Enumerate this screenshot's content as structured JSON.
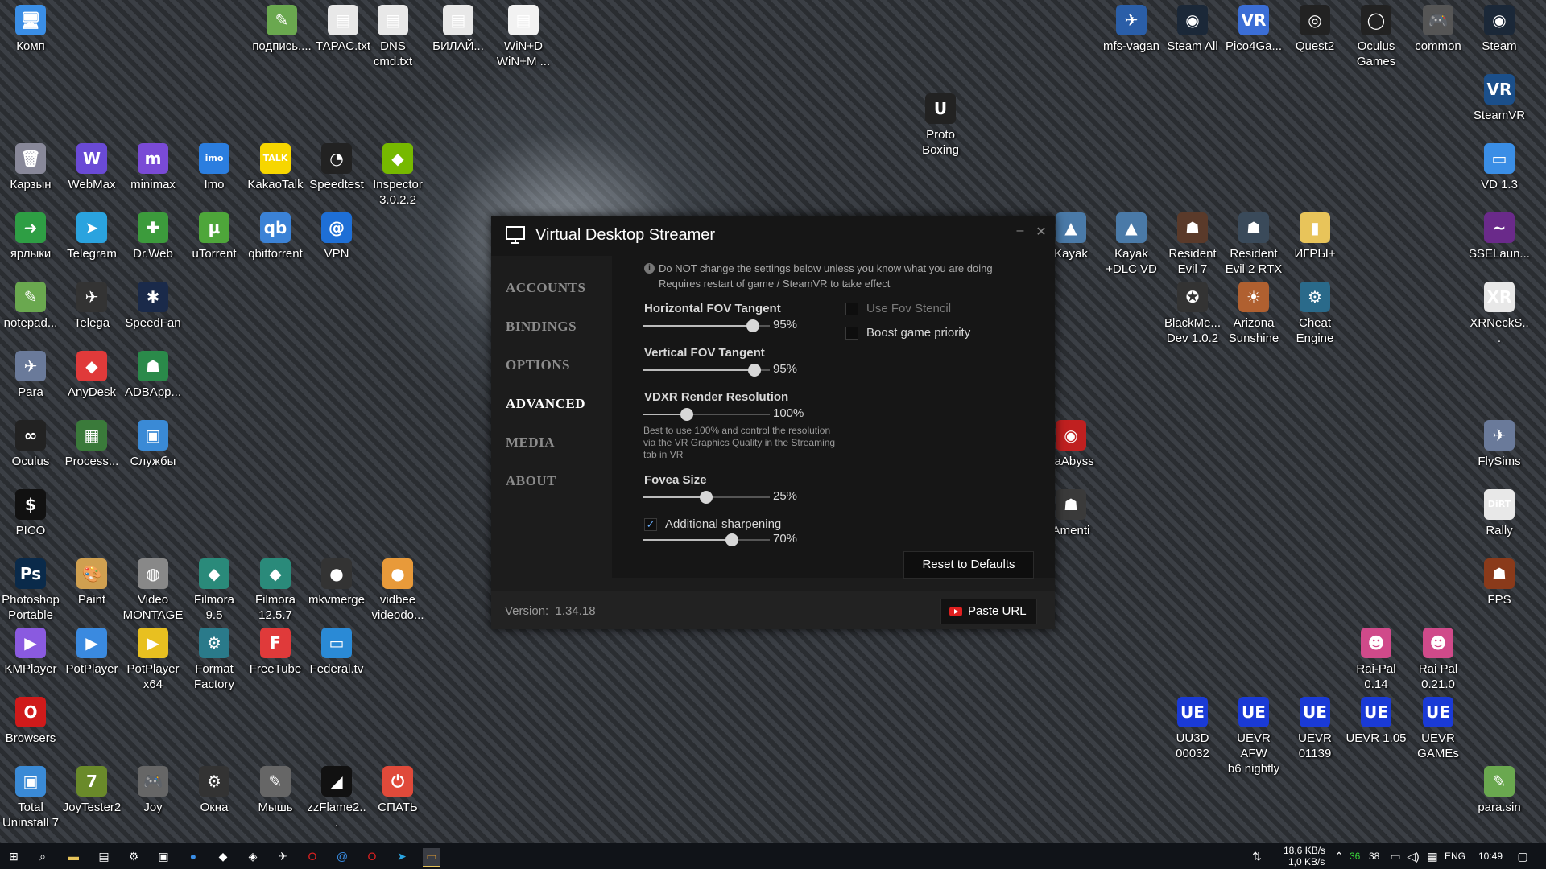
{
  "desktop_icons": [
    {
      "label": "Комп",
      "glyph": "🖥",
      "color": "#3a8ee6",
      "name": "computer-icon"
    },
    {
      "label": "подпись....",
      "glyph": "✎",
      "color": "#6aa84f",
      "name": "notepad-file-icon"
    },
    {
      "label": "ТАРАС.txt",
      "glyph": "▤",
      "color": "#e8e8e8",
      "name": "text-file-icon"
    },
    {
      "label": "DNS\ncmd.txt",
      "glyph": "▤",
      "color": "#e8e8e8",
      "name": "text-file-icon"
    },
    {
      "label": "БИЛАЙ...",
      "glyph": "▤",
      "color": "#e8e8e8",
      "name": "text-file-icon"
    },
    {
      "label": "WiN+D\nWiN+M ...",
      "glyph": "▤",
      "color": "#f2f2f2",
      "name": "text-file-icon"
    },
    {
      "label": "mfs-vagan",
      "glyph": "✈",
      "color": "#2a5ea8",
      "name": "flight-sim-icon"
    },
    {
      "label": "Steam All",
      "glyph": "◉",
      "color": "#1b2838",
      "name": "steam-icon"
    },
    {
      "label": "Pico4Ga...",
      "glyph": "VR",
      "color": "#3b6ed6",
      "name": "vr-icon"
    },
    {
      "label": "Quest2",
      "glyph": "◎",
      "color": "#222",
      "name": "quest-icon"
    },
    {
      "label": "Oculus\nGames",
      "glyph": "◯",
      "color": "#222",
      "name": "oculus-icon"
    },
    {
      "label": "common",
      "glyph": "🎮",
      "color": "#555",
      "name": "gamepad-icon"
    },
    {
      "label": "Steam",
      "glyph": "◉",
      "color": "#1b2838",
      "name": "steam-icon"
    },
    {
      "label": "SteamVR",
      "glyph": "VR",
      "color": "#1b4f8a",
      "name": "steamvr-icon"
    },
    {
      "label": "Proto\nBoxing",
      "glyph": "U",
      "color": "#222",
      "name": "unreal-icon"
    },
    {
      "label": "Карзын",
      "glyph": "🗑",
      "color": "#889",
      "name": "recycle-bin-icon"
    },
    {
      "label": "WebMax",
      "glyph": "W",
      "color": "#6a4ad6",
      "name": "webmax-icon"
    },
    {
      "label": "minimax",
      "glyph": "m",
      "color": "#7a4ad6",
      "name": "minimax-icon"
    },
    {
      "label": "Imo",
      "glyph": "imo",
      "color": "#2b7ee0",
      "name": "imo-icon"
    },
    {
      "label": "KakaoTalk",
      "glyph": "TALK",
      "color": "#f7d600",
      "name": "kakaotalk-icon"
    },
    {
      "label": "Speedtest",
      "glyph": "◔",
      "color": "#222",
      "name": "speedtest-icon"
    },
    {
      "label": "Inspector\n3.0.2.2",
      "glyph": "◆",
      "color": "#76b900",
      "name": "nvidia-icon"
    },
    {
      "label": "VD 1.3",
      "glyph": "▭",
      "color": "#3a8ee6",
      "name": "vd-icon"
    },
    {
      "label": "ярлыки",
      "glyph": "➜",
      "color": "#2e9e44",
      "name": "shortcuts-icon"
    },
    {
      "label": "Telegram",
      "glyph": "➤",
      "color": "#2aa3df",
      "name": "telegram-icon"
    },
    {
      "label": "Dr.Web",
      "glyph": "✚",
      "color": "#3c9b3c",
      "name": "drweb-icon"
    },
    {
      "label": "uTorrent",
      "glyph": "µ",
      "color": "#4ea63a",
      "name": "utorrent-icon"
    },
    {
      "label": "qbittorrent",
      "glyph": "qb",
      "color": "#3b82d6",
      "name": "qbittorrent-icon"
    },
    {
      "label": "VPN",
      "glyph": "@",
      "color": "#1e6fd6",
      "name": "vpn-icon"
    },
    {
      "label": "Kayak",
      "glyph": "▲",
      "color": "#4a7aa8",
      "name": "kayak-icon"
    },
    {
      "label": "Kayak\n+DLC VD",
      "glyph": "▲",
      "color": "#4a7aa8",
      "name": "kayak-icon"
    },
    {
      "label": "Resident\nEvil 7",
      "glyph": "☗",
      "color": "#5a3a2a",
      "name": "game-icon"
    },
    {
      "label": "Resident\nEvil 2 RTX",
      "glyph": "☗",
      "color": "#3a4a5a",
      "name": "game-icon"
    },
    {
      "label": "ИГРЫ+",
      "glyph": "▮",
      "color": "#e8c45a",
      "name": "folder-icon"
    },
    {
      "label": "SSELaun...",
      "glyph": "~",
      "color": "#6a2a8a",
      "name": "game-icon"
    },
    {
      "label": "notepad...",
      "glyph": "✎",
      "color": "#6aa84f",
      "name": "notepad-icon"
    },
    {
      "label": "Telega",
      "glyph": "✈",
      "color": "#333",
      "name": "telega-icon"
    },
    {
      "label": "SpeedFan",
      "glyph": "✱",
      "color": "#1a2a4a",
      "name": "speedfan-icon"
    },
    {
      "label": "BlackMe...\nDev 1.0.2",
      "glyph": "✪",
      "color": "#333",
      "name": "game-icon"
    },
    {
      "label": "Arizona\nSunshine",
      "glyph": "☀",
      "color": "#b06030",
      "name": "game-icon"
    },
    {
      "label": "Cheat\nEngine",
      "glyph": "⚙",
      "color": "#2a6a8a",
      "name": "cheat-engine-icon"
    },
    {
      "label": "XRNeckS...",
      "glyph": "XR",
      "color": "#e8e8e8",
      "name": "xr-icon"
    },
    {
      "label": "Para",
      "glyph": "✈",
      "color": "#6a7a9a",
      "name": "para-icon"
    },
    {
      "label": "AnyDesk",
      "glyph": "◆",
      "color": "#e03a3a",
      "name": "anydesk-icon"
    },
    {
      "label": "ADBApp...",
      "glyph": "☗",
      "color": "#2a8a4a",
      "name": "adb-icon"
    },
    {
      "label": "Oculus",
      "glyph": "∞",
      "color": "#222",
      "name": "meta-icon"
    },
    {
      "label": "Process...",
      "glyph": "▦",
      "color": "#3a7a3a",
      "name": "process-icon"
    },
    {
      "label": "Службы",
      "glyph": "▣",
      "color": "#3a8ad6",
      "name": "services-icon"
    },
    {
      "label": "naAbyss",
      "glyph": "◉",
      "color": "#c02020",
      "name": "game-icon"
    },
    {
      "label": "FlySims",
      "glyph": "✈",
      "color": "#6a7a9a",
      "name": "flysims-icon"
    },
    {
      "label": "PICO",
      "glyph": "$",
      "color": "#111",
      "name": "pico-icon"
    },
    {
      "label": "Amenti",
      "glyph": "☗",
      "color": "#3a3a3a",
      "name": "game-icon"
    },
    {
      "label": "Rally",
      "glyph": "DiRT",
      "color": "#e8e8e8",
      "name": "dirt-icon"
    },
    {
      "label": "Photoshop\nPortable",
      "glyph": "Ps",
      "color": "#0a2a4a",
      "name": "photoshop-icon"
    },
    {
      "label": "Paint",
      "glyph": "🎨",
      "color": "#d0a050",
      "name": "paint-icon"
    },
    {
      "label": "Video\nMONTAGE",
      "glyph": "◍",
      "color": "#888",
      "name": "video-montage-icon"
    },
    {
      "label": "Filmora\n9.5",
      "glyph": "◆",
      "color": "#2a8a7a",
      "name": "filmora-icon"
    },
    {
      "label": "Filmora\n12.5.7",
      "glyph": "◆",
      "color": "#2a8a7a",
      "name": "filmora-icon"
    },
    {
      "label": "mkvmerge",
      "glyph": "●",
      "color": "#333",
      "name": "mkvmerge-icon"
    },
    {
      "label": "vidbee\nvideodo...",
      "glyph": "●",
      "color": "#e89a3a",
      "name": "vidbee-icon"
    },
    {
      "label": "FPS",
      "glyph": "☗",
      "color": "#8a3a1a",
      "name": "game-icon"
    },
    {
      "label": "KMPlayer",
      "glyph": "▶",
      "color": "#8a5ae0",
      "name": "kmplayer-icon"
    },
    {
      "label": "PotPlayer",
      "glyph": "▶",
      "color": "#3a8ae0",
      "name": "potplayer-icon"
    },
    {
      "label": "PotPlayer\nx64",
      "glyph": "▶",
      "color": "#e8c020",
      "name": "potplayer-icon"
    },
    {
      "label": "Format\nFactory",
      "glyph": "⚙",
      "color": "#2a7a8a",
      "name": "format-factory-icon"
    },
    {
      "label": "FreeTube",
      "glyph": "F",
      "color": "#e03a3a",
      "name": "freetube-icon"
    },
    {
      "label": "Federal.tv",
      "glyph": "▭",
      "color": "#2a8ad6",
      "name": "federal-tv-icon"
    },
    {
      "label": "Rai-Pal\n0.14",
      "glyph": "☻",
      "color": "#d04a8a",
      "name": "raipal-icon"
    },
    {
      "label": "Rai Pal\n0.21.0",
      "glyph": "☻",
      "color": "#d04a8a",
      "name": "raipal-icon"
    },
    {
      "label": "Browsers",
      "glyph": "O",
      "color": "#d01a1a",
      "name": "opera-icon"
    },
    {
      "label": "UU3D\n00032",
      "glyph": "UE",
      "color": "#1a3ad6",
      "name": "uevr-icon"
    },
    {
      "label": "UEVR AFW\nb6 nightly",
      "glyph": "UE",
      "color": "#1a3ad6",
      "name": "uevr-icon"
    },
    {
      "label": "UEVR\n01139",
      "glyph": "UE",
      "color": "#1a3ad6",
      "name": "uevr-icon"
    },
    {
      "label": "UEVR 1.05",
      "glyph": "UE",
      "color": "#1a3ad6",
      "name": "uevr-icon"
    },
    {
      "label": "UEVR\nGAMEs",
      "glyph": "UE",
      "color": "#1a3ad6",
      "name": "uevr-icon"
    },
    {
      "label": "Total\nUninstall 7",
      "glyph": "▣",
      "color": "#3a8ad6",
      "name": "uninstall-icon"
    },
    {
      "label": "JoyTester2",
      "glyph": "7",
      "color": "#6a8a2a",
      "name": "joytester-icon"
    },
    {
      "label": "Joy",
      "glyph": "🎮",
      "color": "#666",
      "name": "gamepad-icon"
    },
    {
      "label": "Окна",
      "glyph": "⚙",
      "color": "#333",
      "name": "gear-icon"
    },
    {
      "label": "Мышь",
      "glyph": "✎",
      "color": "#666",
      "name": "mouse-icon"
    },
    {
      "label": "zzFlame2...",
      "glyph": "◢",
      "color": "#111",
      "name": "flame-icon"
    },
    {
      "label": "СПАТЬ",
      "glyph": "⏻",
      "color": "#e04a3a",
      "name": "power-icon"
    },
    {
      "label": "para.sin",
      "glyph": "✎",
      "color": "#6aa84f",
      "name": "notepad-file-icon"
    }
  ],
  "window": {
    "title": "Virtual Desktop Streamer",
    "minimize": "–",
    "close": "✕",
    "nav": [
      "ACCOUNTS",
      "BINDINGS",
      "OPTIONS",
      "ADVANCED",
      "MEDIA",
      "ABOUT"
    ],
    "active_nav": "ADVANCED",
    "info_line1": "Do NOT change the settings below unless you know what you are doing",
    "info_line2": "Requires restart of game / SteamVR to take effect",
    "sliders": {
      "horizontal_fov": {
        "label": "Horizontal FOV Tangent",
        "value_text": "95%",
        "fraction": 0.87
      },
      "vertical_fov": {
        "label": "Vertical FOV Tangent",
        "value_text": "95%",
        "fraction": 0.88
      },
      "render_resolution": {
        "label": "VDXR Render Resolution",
        "value_text": "100%",
        "fraction": 0.35
      },
      "fovea_size": {
        "label": "Fovea Size",
        "value_text": "25%",
        "fraction": 0.5
      },
      "sharpening": {
        "value_text": "70%",
        "fraction": 0.7
      }
    },
    "resolution_note": "Best to use 100% and control the resolution via the VR Graphics Quality in the Streaming tab in VR",
    "use_fov_stencil": {
      "label": "Use Fov Stencil",
      "checked": false
    },
    "boost_priority": {
      "label": "Boost game priority",
      "checked": false
    },
    "additional_sharpening": {
      "label": "Additional sharpening",
      "checked": true
    },
    "reset_button": "Reset to Defaults",
    "version_label": "Version:",
    "version_value": "1.34.18",
    "paste_url": "Paste URL"
  },
  "taskbar": {
    "net_down": "18,6 KB/s",
    "net_up": "1,0 KB/s",
    "temp1": "36",
    "temp2": "38",
    "lang": "ENG",
    "time": "10:49"
  }
}
